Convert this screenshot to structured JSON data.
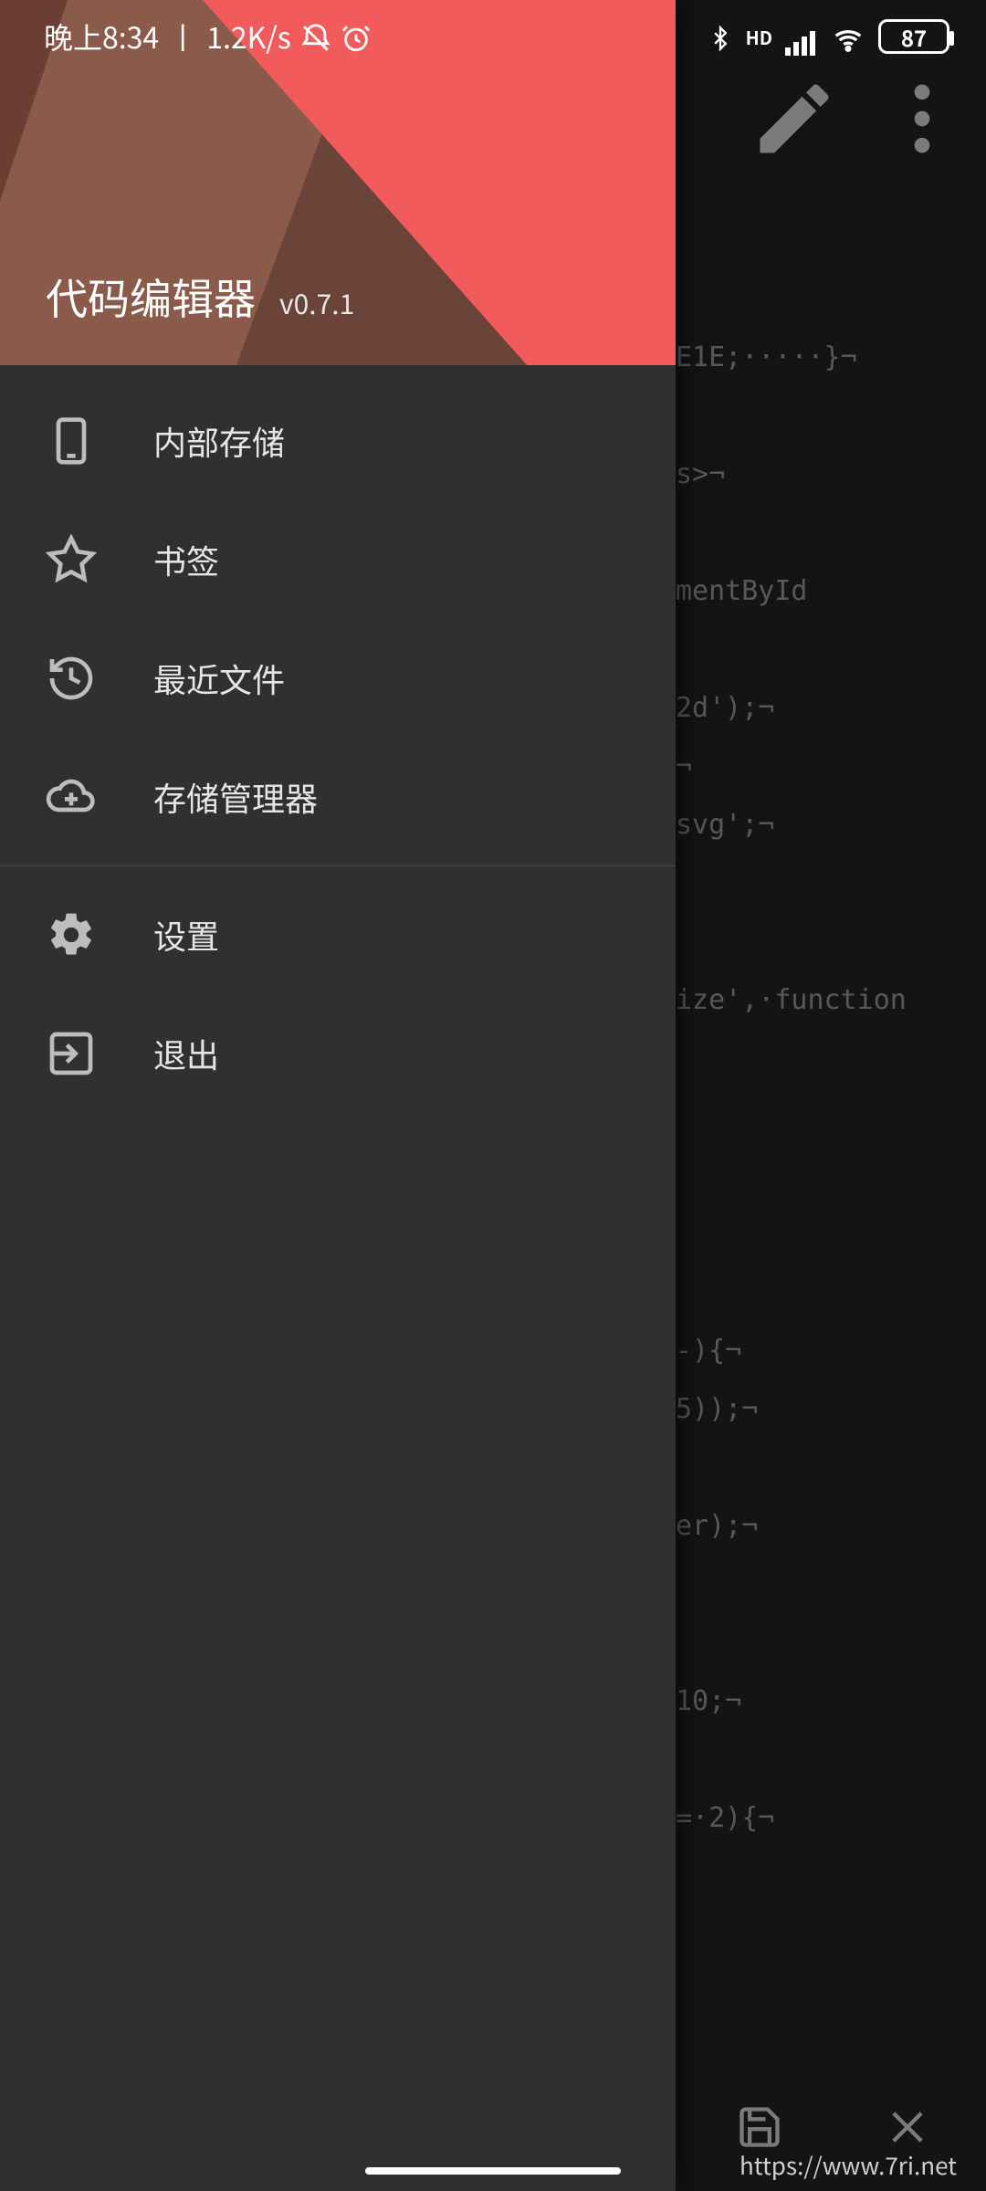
{
  "statusbar": {
    "time": "晚上8:34",
    "net_speed": "1.2K/s",
    "battery": "87"
  },
  "drawer": {
    "title": "代码编辑器",
    "version": "v0.7.1",
    "items": [
      {
        "label": "内部存储",
        "icon": "phone-icon"
      },
      {
        "label": "书签",
        "icon": "star-icon"
      },
      {
        "label": "最近文件",
        "icon": "history-icon"
      },
      {
        "label": "存储管理器",
        "icon": "cloud-plus-icon"
      }
    ],
    "secondary": [
      {
        "label": "设置",
        "icon": "gear-icon"
      },
      {
        "label": "退出",
        "icon": "exit-icon"
      }
    ]
  },
  "editor": {
    "code_lines": [
      "E1E;·····}¬",
      "",
      "s>¬",
      "",
      "mentById",
      "",
      "2d');¬",
      "¬",
      "svg';¬",
      "",
      "",
      "ize',·function",
      "",
      "",
      "",
      "",
      "",
      "-){¬",
      "5));¬",
      "",
      "er);¬",
      "",
      "",
      "10;¬",
      "",
      "=·2){¬"
    ]
  },
  "watermark": "https://www.7ri.net"
}
